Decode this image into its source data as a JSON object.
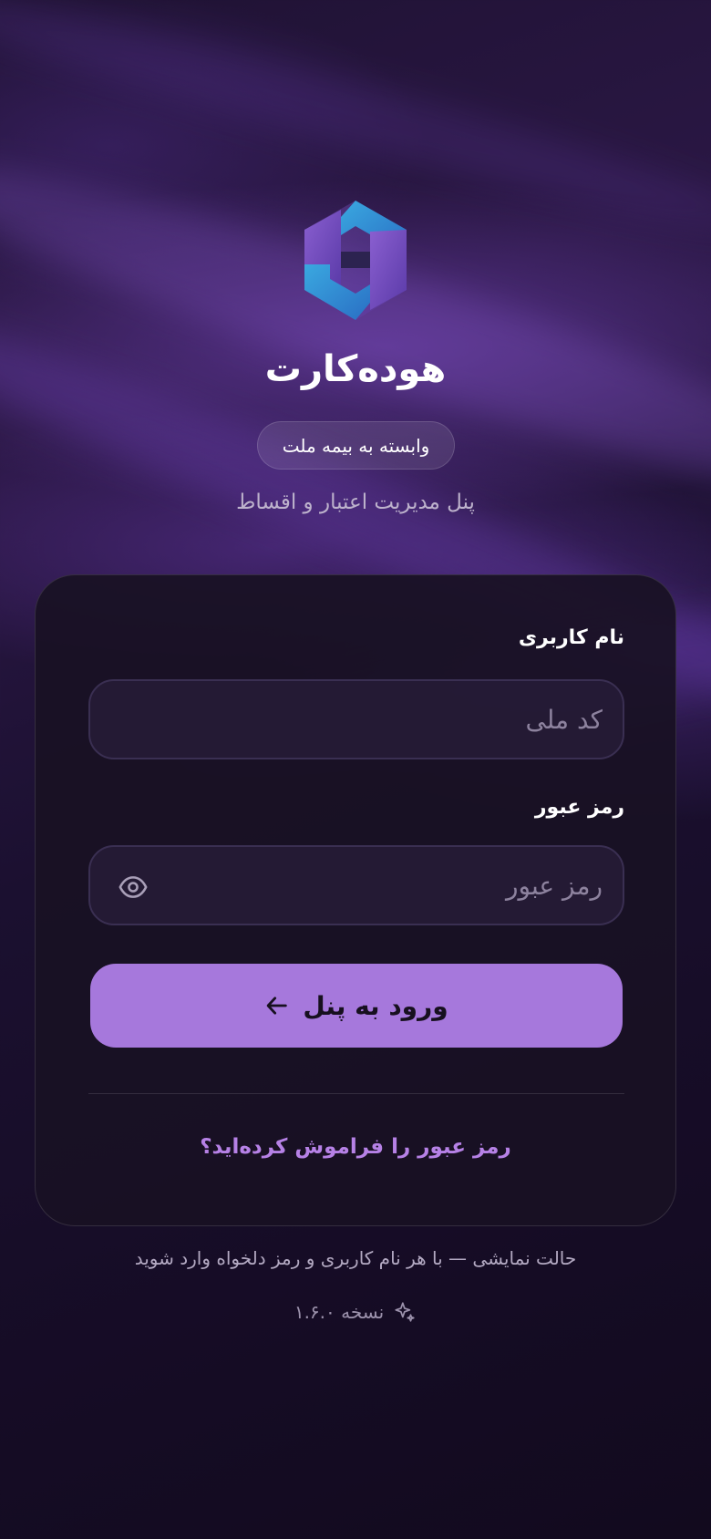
{
  "brand": {
    "name": "هوده‌کارت",
    "affiliation_badge": "وابسته به بیمه ملت",
    "subtitle": "پنل مدیریت اعتبار و اقساط",
    "logo_icon": "hexagon-h-logo"
  },
  "login_form": {
    "username_label": "نام کاربری",
    "username_placeholder": "کد ملی",
    "username_value": "",
    "password_label": "رمز عبور",
    "password_placeholder": "رمز عبور",
    "password_value": "",
    "password_toggle_icon": "eye-icon",
    "submit_label": "ورود به پنل",
    "submit_icon": "arrow-left-icon",
    "forgot_password_link": "رمز عبور را فراموش کرده‌اید؟"
  },
  "footer": {
    "demo_note": "حالت نمایشی — با هر نام کاربری و رمز دلخواه وارد شوید",
    "version_label": "نسخه ۱.۶.۰",
    "version_icon": "sparkle-icon"
  },
  "colors": {
    "accent": "#a678dc",
    "link": "#b681e6",
    "card_background": "#191124",
    "page_background": "#1b1030"
  }
}
